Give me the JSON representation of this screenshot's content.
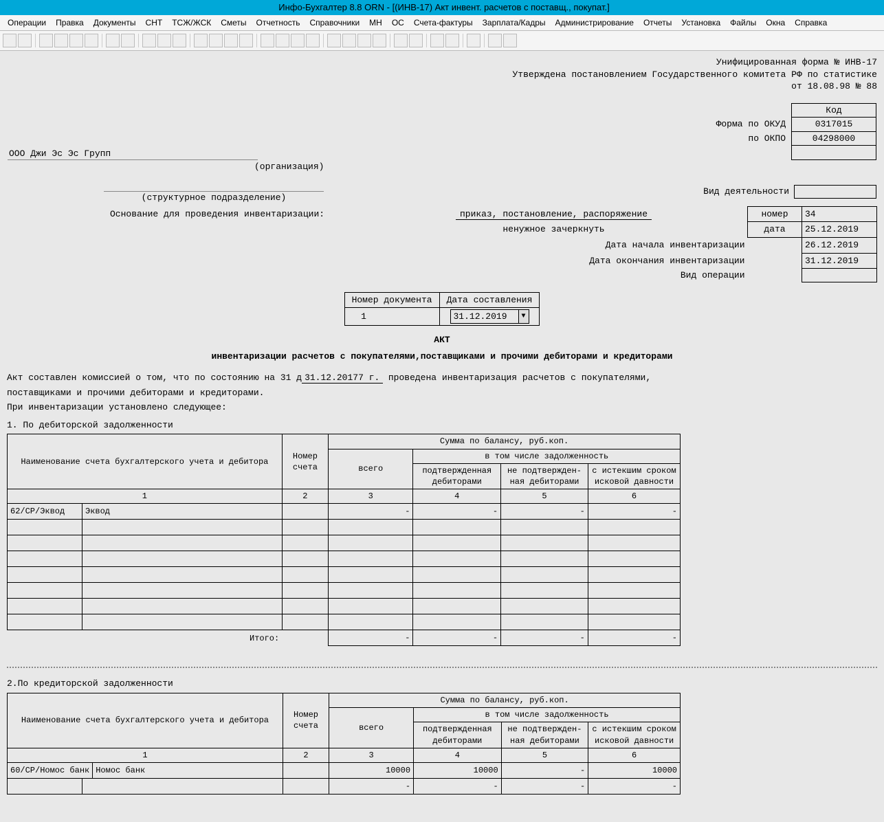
{
  "titlebar": "Инфо-Бухгалтер 8.8   ORN   -  [(ИНВ-17) Акт инвент. расчетов с поставщ., покупат.]",
  "menu": [
    "Операции",
    "Правка",
    "Документы",
    "СНТ",
    "ТСЖ/ЖСК",
    "Сметы",
    "Отчетность",
    "Справочники",
    "МН",
    "ОС",
    "Счета-фактуры",
    "Зарплата/Кадры",
    "Администрирование",
    "Отчеты",
    "Установка",
    "Файлы",
    "Окна",
    "Справка"
  ],
  "header": {
    "l1": "Унифицированная форма № ИНВ-17",
    "l2": "Утверждена постановлением Государственного комитета РФ по статистике",
    "l3": "от 18.08.98 № 88"
  },
  "codes": {
    "kod": "Код",
    "okud_lbl": "Форма по ОКУД",
    "okud": "0317015",
    "okpo_lbl": "по ОКПО",
    "okpo": "04298000"
  },
  "org": {
    "name": "ООО Джи Эс Эс Групп",
    "caption": "(организация)",
    "struct_caption": "(структурное подразделение)",
    "vid_deyat": "Вид деятельности"
  },
  "basis": {
    "label": "Основание для проведения инвентаризации:",
    "options": "приказ, постановление, распоряжение",
    "strike": "ненужное зачеркнуть",
    "nomer_lbl": "номер",
    "nomer": "34",
    "data_lbl": "дата",
    "data": "25.12.2019",
    "start_lbl": "Дата начала инвентаризации",
    "start": "26.12.2019",
    "end_lbl": "Дата окончания инвентаризации",
    "end": "31.12.2019",
    "oper_lbl": "Вид операции",
    "oper": ""
  },
  "doc": {
    "num_lbl": "Номер документа",
    "num": "1",
    "date_lbl": "Дата составления",
    "date": "31.12.2019"
  },
  "title": "АКТ",
  "subtitle": "инвентаризации расчетов с покупателями,поставщиками и прочими дебиторами и кредиторами",
  "body": {
    "p1a": "Акт составлен комиссией о том, что по состоянию на  31 д",
    "p1_date": "31.12.20177 г.",
    "p1b": "  проведена инвентаризация расчетов с покупателями,",
    "p2": "поставщиками и прочими дебиторами и кредиторами.",
    "p3": "При инвентаризации установлено следующее:"
  },
  "section1": "1. По дебиторской задолженности",
  "section2": "2.По кредиторской задолженности",
  "th": {
    "name": "Наименование счета бухгалтерского учета и дебитора",
    "acct": "Номер счета",
    "sum": "Сумма по балансу, руб.коп.",
    "total": "всего",
    "incl": "в том числе задолженность",
    "c1": "подтвержденная дебиторами",
    "c2": "не подтвержден-ная дебиторами",
    "c3": "с истекшим сроком исковой давности",
    "n1": "1",
    "n2": "2",
    "n3": "3",
    "n4": "4",
    "n5": "5",
    "n6": "6",
    "itogo": "Итого:"
  },
  "debitors": [
    {
      "code": "62/СР/Эквод",
      "name": "Эквод",
      "total": "-",
      "a": "-",
      "b": "-",
      "c": "-"
    }
  ],
  "creditors": [
    {
      "code": "60/СР/Номос банк",
      "name": "Номос банк",
      "total": "10000",
      "a": "10000",
      "b": "-",
      "c": "10000"
    }
  ]
}
